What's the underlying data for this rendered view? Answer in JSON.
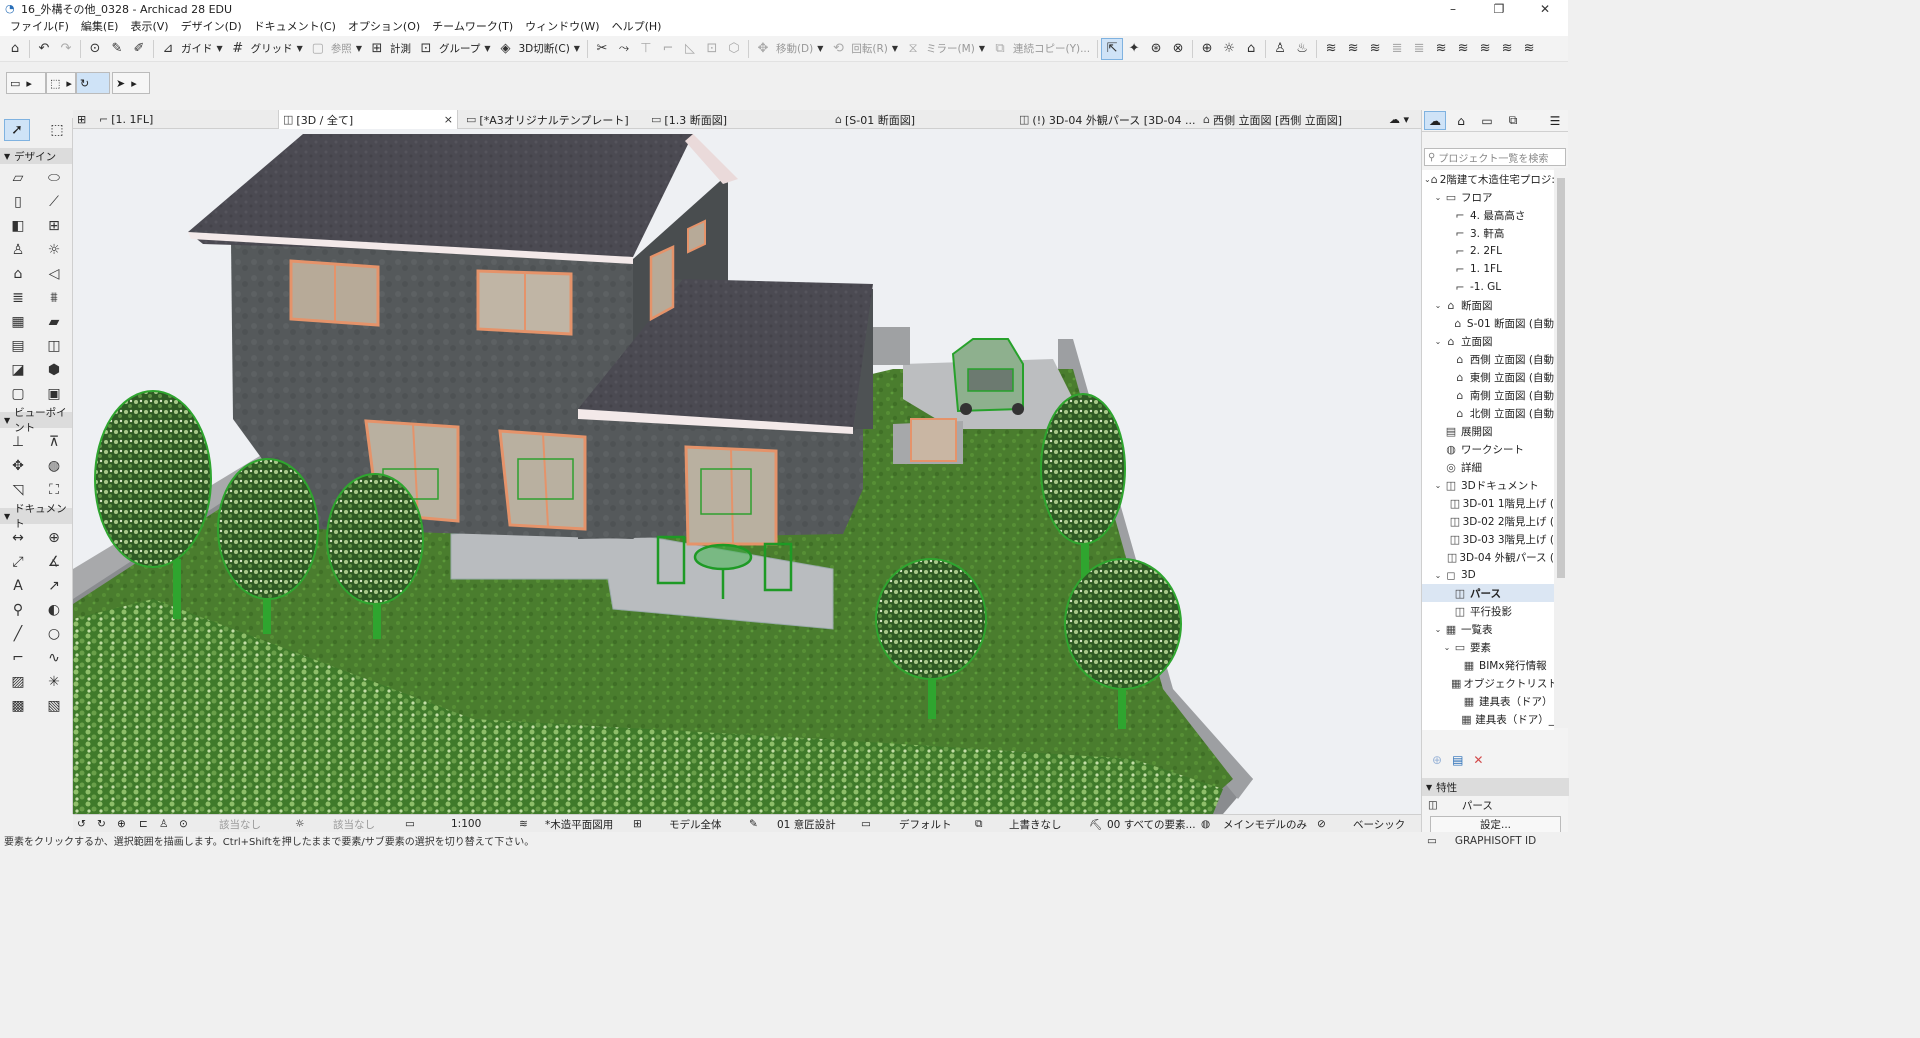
{
  "window": {
    "title": "16_外構その他_0328 - Archicad 28 EDU",
    "app_icon": "archicad-icon",
    "controls": [
      "–",
      "❐",
      "✕"
    ]
  },
  "menu": [
    "ファイル(F)",
    "編集(E)",
    "表示(V)",
    "デザイン(D)",
    "ドキュメント(C)",
    "オプション(O)",
    "チームワーク(T)",
    "ウィンドウ(W)",
    "ヘルプ(H)"
  ],
  "toolbar": {
    "guide": "ガイド",
    "grid": "グリッド",
    "reference": "参照",
    "measure": "計測",
    "group": "グループ",
    "section3d": "3D切断(C)",
    "move": "移動(D)",
    "rotate": "回転(R)",
    "mirror": "ミラー(M)",
    "multiply": "連続コピー(Y)..."
  },
  "toolbox": {
    "design_header": "デザイン",
    "viewpoint_header": "ビューポイント",
    "document_header": "ドキュメント"
  },
  "tabs": [
    {
      "label": "[1. 1FL]",
      "icon": "floorplan-icon"
    },
    {
      "label": "[3D / 全て]",
      "icon": "3d-icon",
      "active": true
    },
    {
      "label": "[*A3オリジナルテンプレート]",
      "icon": "layout-icon"
    },
    {
      "label": "[1.3 断面図]",
      "icon": "section-icon"
    },
    {
      "label": "[S-01 断面図]",
      "icon": "section-icon"
    },
    {
      "label": "(!) 3D-04 外観パース [3D-04 ...",
      "icon": "3d-document-icon"
    },
    {
      "label": "西側 立面図 [西側 立面図]",
      "icon": "elevation-icon"
    }
  ],
  "navigator": {
    "search_placeholder": "プロジェクト一覧を検索",
    "tree": [
      {
        "label": "2階建て木造住宅プロジ:",
        "level": 0,
        "twisty": "v",
        "icon": "project-icon"
      },
      {
        "label": "フロア",
        "level": 1,
        "twisty": "v",
        "icon": "folder-icon"
      },
      {
        "label": "4. 最高高さ",
        "level": 2,
        "icon": "floor-icon"
      },
      {
        "label": "3. 軒高",
        "level": 2,
        "icon": "floor-icon"
      },
      {
        "label": "2. 2FL",
        "level": 2,
        "icon": "floor-icon"
      },
      {
        "label": "1. 1FL",
        "level": 2,
        "icon": "floor-icon"
      },
      {
        "label": "-1. GL",
        "level": 2,
        "icon": "floor-icon"
      },
      {
        "label": "断面図",
        "level": 1,
        "twisty": "v",
        "icon": "section-icon"
      },
      {
        "label": "S-01 断面図 (自動",
        "level": 2,
        "icon": "section-icon"
      },
      {
        "label": "立面図",
        "level": 1,
        "twisty": "v",
        "icon": "elevation-icon"
      },
      {
        "label": "西側 立面図 (自動",
        "level": 2,
        "icon": "elevation-icon"
      },
      {
        "label": "東側 立面図 (自動",
        "level": 2,
        "icon": "elevation-icon"
      },
      {
        "label": "南側 立面図 (自動",
        "level": 2,
        "icon": "elevation-icon"
      },
      {
        "label": "北側 立面図 (自動",
        "level": 2,
        "icon": "elevation-icon"
      },
      {
        "label": "展開図",
        "level": 1,
        "icon": "interior-elevation-icon"
      },
      {
        "label": "ワークシート",
        "level": 1,
        "icon": "worksheet-icon"
      },
      {
        "label": "詳細",
        "level": 1,
        "icon": "detail-icon"
      },
      {
        "label": "3Dドキュメント",
        "level": 1,
        "twisty": "v",
        "icon": "3d-document-icon"
      },
      {
        "label": "3D-01 1階見上げ (",
        "level": 2,
        "icon": "3d-document-icon"
      },
      {
        "label": "3D-02 2階見上げ (",
        "level": 2,
        "icon": "3d-document-icon"
      },
      {
        "label": "3D-03 3階見上げ (",
        "level": 2,
        "icon": "3d-document-icon"
      },
      {
        "label": "3D-04 外観パース (",
        "level": 2,
        "icon": "3d-document-icon"
      },
      {
        "label": "3D",
        "level": 1,
        "twisty": "v",
        "icon": "3d-icon"
      },
      {
        "label": "パース",
        "level": 2,
        "icon": "perspective-icon",
        "selected": true
      },
      {
        "label": "平行投影",
        "level": 2,
        "icon": "axonometry-icon"
      },
      {
        "label": "一覧表",
        "level": 1,
        "twisty": "v",
        "icon": "schedule-icon"
      },
      {
        "label": "要素",
        "level": 2,
        "twisty": "v",
        "icon": "folder-icon"
      },
      {
        "label": "BIMx発行情報",
        "level": 3,
        "icon": "schedule-icon"
      },
      {
        "label": "オブジェクトリスト",
        "level": 3,
        "icon": "schedule-icon"
      },
      {
        "label": "建具表（ドア）",
        "level": 3,
        "icon": "schedule-icon"
      },
      {
        "label": "建具表（ドア）_",
        "level": 3,
        "icon": "schedule-icon"
      }
    ],
    "properties_header": "特性",
    "properties_value": "パース",
    "settings_button": "設定..."
  },
  "quick_options": {
    "none1": "該当なし",
    "none2": "該当なし",
    "scale": "1:100",
    "layer_combo": "*木造平面図用",
    "model_view": "モデル全体",
    "pen_set": "01 意匠設計",
    "dimension": "デフォルト",
    "override": "上書きなし",
    "renovation": "00 すべての要素...",
    "structural": "メインモデルのみ",
    "mvo": "ベーシック"
  },
  "status": {
    "hint": "要素をクリックするか、選択範囲を描画します。Ctrl+Shiftを押したままで要素/サブ要素の選択を切り替えて下さい。",
    "graphisoft_id": "GRAPHISOFT ID"
  },
  "colors": {
    "accent_selection": "#cfe3f7",
    "roof": "#4b4a52",
    "wall": "#55595b",
    "grass": "#4a7d2e",
    "window_frame": "#e5936a",
    "tree_green": "#2f7a24"
  }
}
